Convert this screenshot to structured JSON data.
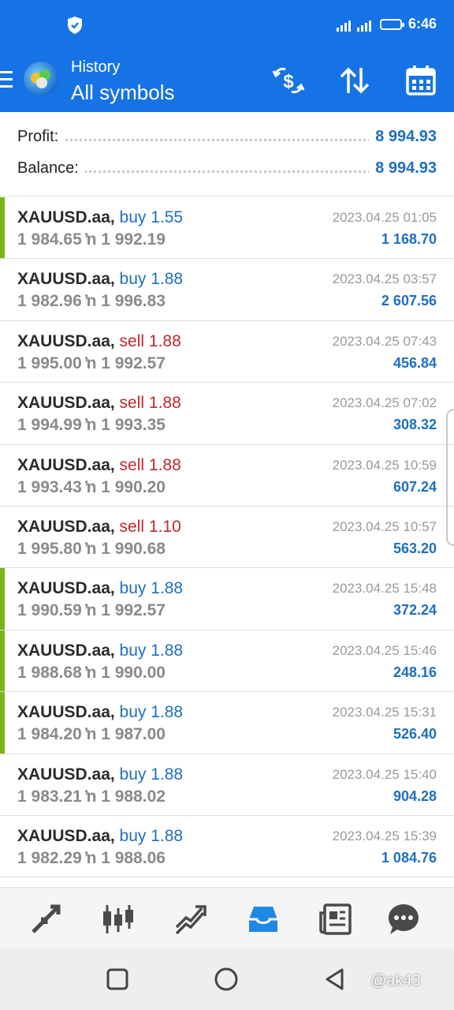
{
  "status_bar": {
    "time": "6:46"
  },
  "app_bar": {
    "subtitle": "History",
    "title": "All symbols"
  },
  "summary": {
    "profit_label": "Profit:",
    "profit_value": "8 994.93",
    "balance_label": "Balance:",
    "balance_value": "8 994.93"
  },
  "trades": [
    {
      "symbol": "XAUUSD.aa,",
      "side": "buy",
      "volume": "1.55",
      "prices": "1 984.65 ̓n 1 992.19",
      "date": "2023.04.25 01:05",
      "profit": "1 168.70",
      "marked": true
    },
    {
      "symbol": "XAUUSD.aa,",
      "side": "buy",
      "volume": "1.88",
      "prices": "1 982.96 ̓n 1 996.83",
      "date": "2023.04.25 03:57",
      "profit": "2 607.56",
      "marked": false
    },
    {
      "symbol": "XAUUSD.aa,",
      "side": "sell",
      "volume": "1.88",
      "prices": "1 995.00 ̓n 1 992.57",
      "date": "2023.04.25 07:43",
      "profit": "456.84",
      "marked": false
    },
    {
      "symbol": "XAUUSD.aa,",
      "side": "sell",
      "volume": "1.88",
      "prices": "1 994.99 ̓n 1 993.35",
      "date": "2023.04.25 07:02",
      "profit": "308.32",
      "marked": false
    },
    {
      "symbol": "XAUUSD.aa,",
      "side": "sell",
      "volume": "1.88",
      "prices": "1 993.43 ̓n 1 990.20",
      "date": "2023.04.25 10:59",
      "profit": "607.24",
      "marked": false
    },
    {
      "symbol": "XAUUSD.aa,",
      "side": "sell",
      "volume": "1.10",
      "prices": "1 995.80 ̓n 1 990.68",
      "date": "2023.04.25 10:57",
      "profit": "563.20",
      "marked": false
    },
    {
      "symbol": "XAUUSD.aa,",
      "side": "buy",
      "volume": "1.88",
      "prices": "1 990.59 ̓n 1 992.57",
      "date": "2023.04.25 15:48",
      "profit": "372.24",
      "marked": true
    },
    {
      "symbol": "XAUUSD.aa,",
      "side": "buy",
      "volume": "1.88",
      "prices": "1 988.68 ̓n 1 990.00",
      "date": "2023.04.25 15:46",
      "profit": "248.16",
      "marked": true
    },
    {
      "symbol": "XAUUSD.aa,",
      "side": "buy",
      "volume": "1.88",
      "prices": "1 984.20 ̓n 1 987.00",
      "date": "2023.04.25 15:31",
      "profit": "526.40",
      "marked": true
    },
    {
      "symbol": "XAUUSD.aa,",
      "side": "buy",
      "volume": "1.88",
      "prices": "1 983.21 ̓n 1 988.02",
      "date": "2023.04.25 15:40",
      "profit": "904.28",
      "marked": false
    },
    {
      "symbol": "XAUUSD.aa,",
      "side": "buy",
      "volume": "1.88",
      "prices": "1 982.29 ̓n 1 988.06",
      "date": "2023.04.25 15:39",
      "profit": "1 084.76",
      "marked": false
    }
  ],
  "bottom_tabs": [
    {
      "icon": "quotes-icon",
      "active": false
    },
    {
      "icon": "chart-icon",
      "active": false
    },
    {
      "icon": "trade-icon",
      "active": false
    },
    {
      "icon": "history-icon",
      "active": true
    },
    {
      "icon": "news-icon",
      "active": false
    },
    {
      "icon": "chat-icon",
      "active": false
    }
  ],
  "watermark": "@ak43",
  "colors": {
    "primary": "#1673e6",
    "buy": "#1e6fc0",
    "sell": "#c0272d",
    "marker": "#7cb518",
    "tab_inactive": "#4a4a4a",
    "tab_active": "#1e88e5"
  }
}
